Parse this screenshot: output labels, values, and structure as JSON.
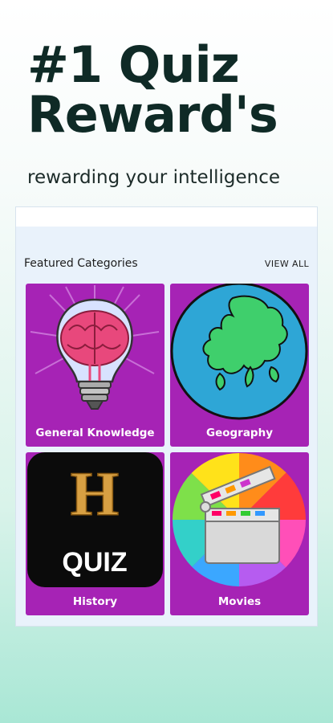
{
  "hero": {
    "title_line1": "#1 Quiz",
    "title_line2": "Reward's",
    "tagline": "rewarding your intelligence"
  },
  "section": {
    "title": "Featured Categories",
    "view_all": "VIEW ALL"
  },
  "categories": [
    {
      "label": "General Knowledge",
      "icon": "brain-lightbulb-icon"
    },
    {
      "label": "Geography",
      "icon": "globe-europe-icon"
    },
    {
      "label": "History",
      "icon": "history-quiz-icon",
      "icon_text_big": "H",
      "icon_text_small": "QUIZ"
    },
    {
      "label": "Movies",
      "icon": "clapperboard-icon"
    }
  ],
  "colors": {
    "card_bg": "#a623b5",
    "title_text": "#0f2a26",
    "panel_bg": "#e9f2fb"
  }
}
